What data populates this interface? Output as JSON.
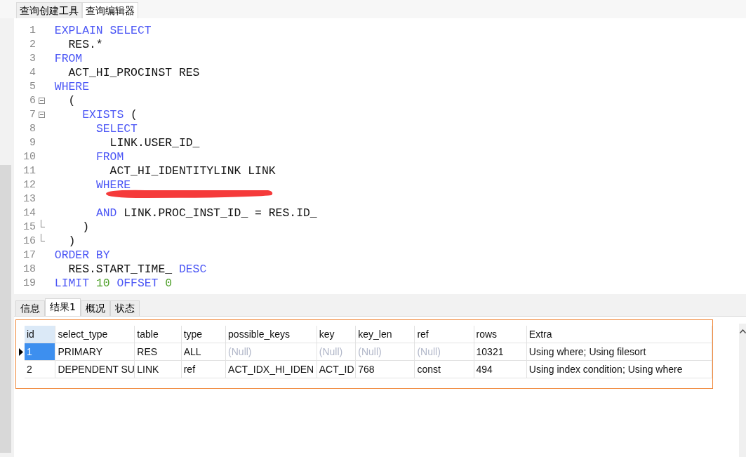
{
  "top_tabs": [
    {
      "label": "查询创建工具",
      "selected": false
    },
    {
      "label": "查询编辑器",
      "selected": true
    }
  ],
  "editor": {
    "lines": [
      {
        "number": "1",
        "tokens": [
          {
            "kind": "keyword",
            "text": "EXPLAIN SELECT"
          }
        ],
        "children": [
          {
            "number": "2",
            "tokens": [
              {
                "kind": "plain",
                "text": "RES.*"
              }
            ]
          }
        ]
      },
      {
        "number": "3",
        "tokens": [
          {
            "kind": "keyword",
            "text": "FROM"
          }
        ],
        "children": [
          {
            "number": "4",
            "tokens": [
              {
                "kind": "plain",
                "text": "ACT_HI_PROCINST RES"
              }
            ]
          }
        ]
      },
      {
        "number": "5",
        "tokens": [
          {
            "kind": "keyword",
            "text": "WHERE"
          }
        ],
        "children": [
          {
            "number": "6",
            "fold": true,
            "tokens": [
              {
                "kind": "plain",
                "text": "("
              }
            ],
            "children": [
              {
                "number": "7",
                "fold": true,
                "tokens": [
                  {
                    "kind": "keyword",
                    "text": "EXISTS"
                  },
                  {
                    "kind": "plain",
                    "text": " ("
                  }
                ],
                "children": [
                  {
                    "number": "8",
                    "tokens": [
                      {
                        "kind": "keyword",
                        "text": "SELECT"
                      }
                    ],
                    "children": [
                      {
                        "number": "9",
                        "tokens": [
                          {
                            "kind": "plain",
                            "text": "LINK.USER_ID_"
                          }
                        ]
                      }
                    ]
                  },
                  {
                    "number": "10",
                    "tokens": [
                      {
                        "kind": "keyword",
                        "text": "FROM"
                      }
                    ],
                    "children": [
                      {
                        "number": "11",
                        "tokens": [
                          {
                            "kind": "plain",
                            "text": "ACT_HI_IDENTITYLINK LINK"
                          }
                        ]
                      }
                    ]
                  },
                  {
                    "number": "12",
                    "tokens": [
                      {
                        "kind": "keyword",
                        "text": "WHERE"
                      }
                    ],
                    "children": [
                      {
                        "number": "13",
                        "redacted": true
                      }
                    ]
                  },
                  {
                    "number": "14",
                    "tokens": [
                      {
                        "kind": "keyword",
                        "text": "AND"
                      },
                      {
                        "kind": "plain",
                        "text": " LINK.PROC_INST_ID_ = RES.ID_"
                      }
                    ]
                  }
                ]
              },
              {
                "number": "15",
                "fold_end": true,
                "tokens": [
                  {
                    "kind": "plain",
                    "text": ")"
                  }
                ]
              }
            ]
          },
          {
            "number": "16",
            "fold_end": true,
            "tokens": [
              {
                "kind": "plain",
                "text": ")"
              }
            ]
          }
        ]
      },
      {
        "number": "17",
        "tokens": [
          {
            "kind": "keyword",
            "text": "ORDER BY"
          }
        ],
        "children": [
          {
            "number": "18",
            "tokens": [
              {
                "kind": "plain",
                "text": "RES.START_TIME_ "
              },
              {
                "kind": "keyword",
                "text": "DESC"
              }
            ]
          }
        ]
      },
      {
        "number": "19",
        "tokens": [
          {
            "kind": "keyword",
            "text": "LIMIT "
          },
          {
            "kind": "number",
            "text": "10"
          },
          {
            "kind": "keyword",
            "text": " OFFSET "
          },
          {
            "kind": "number",
            "text": "0"
          }
        ]
      }
    ]
  },
  "result_tabs": [
    {
      "label": "信息",
      "selected": false
    },
    {
      "label": "结果1",
      "selected": true
    },
    {
      "label": "概况",
      "selected": false
    },
    {
      "label": "状态",
      "selected": false
    }
  ],
  "table": {
    "columns": [
      "id",
      "select_type",
      "table",
      "type",
      "possible_keys",
      "key",
      "key_len",
      "ref",
      "rows",
      "Extra"
    ],
    "rows": [
      {
        "selected": true,
        "cells": [
          {
            "text": "1",
            "null": false
          },
          {
            "text": "PRIMARY",
            "null": false
          },
          {
            "text": "RES",
            "null": false
          },
          {
            "text": "ALL",
            "null": false
          },
          {
            "text": "(Null)",
            "null": true
          },
          {
            "text": "(Null)",
            "null": true
          },
          {
            "text": "(Null)",
            "null": true
          },
          {
            "text": "(Null)",
            "null": true
          },
          {
            "text": "10321",
            "null": false
          },
          {
            "text": "Using where; Using filesort",
            "null": false
          }
        ]
      },
      {
        "selected": false,
        "cells": [
          {
            "text": "2",
            "null": false
          },
          {
            "text": "DEPENDENT SU",
            "null": false
          },
          {
            "text": "LINK",
            "null": false
          },
          {
            "text": "ref",
            "null": false
          },
          {
            "text": "ACT_IDX_HI_IDEN",
            "null": false
          },
          {
            "text": "ACT_ID",
            "null": false
          },
          {
            "text": "768",
            "null": false
          },
          {
            "text": "const",
            "null": false
          },
          {
            "text": "494",
            "null": false
          },
          {
            "text": "Using index condition; Using where",
            "null": false
          }
        ]
      }
    ]
  }
}
